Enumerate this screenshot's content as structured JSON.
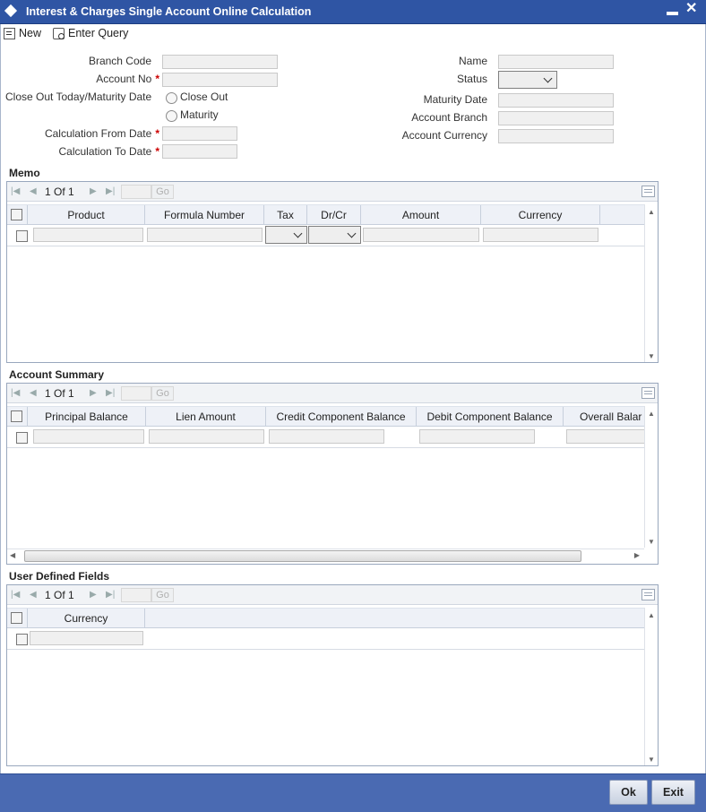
{
  "window": {
    "title": "Interest & Charges Single Account Online Calculation",
    "minimize": "▬",
    "close": "✕"
  },
  "toolbar": {
    "new_label": "New",
    "enter_query_label": "Enter Query"
  },
  "form": {
    "branch_code_label": "Branch Code",
    "account_no_label": "Account No",
    "close_out_label": "Close Out Today/Maturity Date",
    "close_out_option": "Close Out",
    "maturity_option": "Maturity",
    "calc_from_label": "Calculation From Date",
    "calc_to_label": "Calculation To Date",
    "required_mark": "*",
    "name_label": "Name",
    "status_label": "Status",
    "maturity_date_label": "Maturity Date",
    "account_branch_label": "Account Branch",
    "account_currency_label": "Account Currency"
  },
  "memo": {
    "title": "Memo",
    "pager": {
      "text": "1 Of 1",
      "go": "Go"
    },
    "columns": [
      "Product",
      "Formula Number",
      "Tax",
      "Dr/Cr",
      "Amount",
      "Currency"
    ]
  },
  "summary": {
    "title": "Account Summary",
    "pager": {
      "text": "1 Of 1",
      "go": "Go"
    },
    "columns": [
      "Principal Balance",
      "Lien Amount",
      "Credit Component Balance",
      "Debit Component Balance",
      "Overall Balar"
    ]
  },
  "udf": {
    "title": "User Defined Fields",
    "pager": {
      "text": "1 Of 1",
      "go": "Go"
    },
    "columns": [
      "Currency"
    ]
  },
  "footer": {
    "ok_label": "Ok",
    "exit_label": "Exit"
  },
  "colors": {
    "titlebar": "#2f55a4",
    "footer": "#4a6ab2"
  }
}
